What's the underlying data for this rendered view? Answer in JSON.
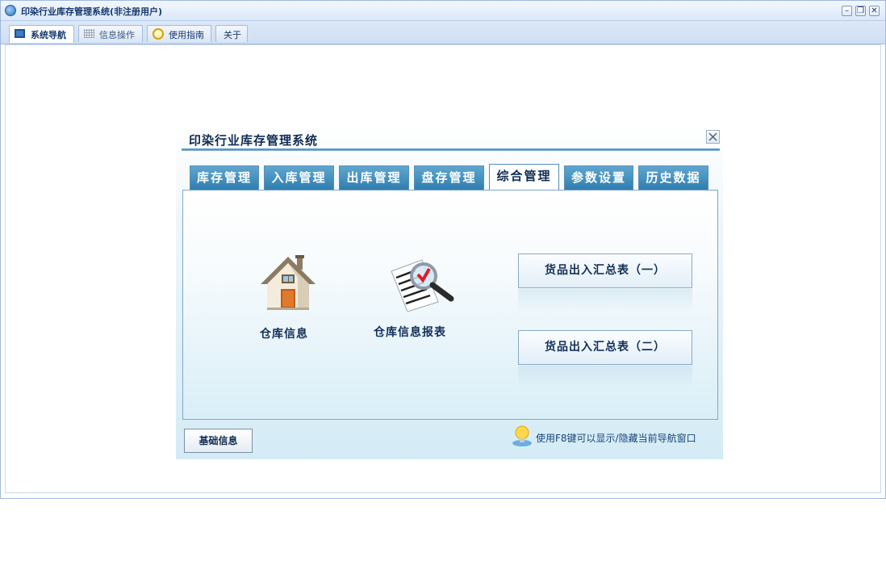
{
  "window": {
    "title": "印染行业库存管理系统(非注册用户)",
    "controls": {
      "minimize": "–",
      "restore": "❐",
      "close": "✕"
    }
  },
  "main_tabs": [
    {
      "label": "系统导航",
      "icon": "monitor-icon",
      "active": true
    },
    {
      "label": "信息操作",
      "icon": "grid-icon",
      "active": false
    },
    {
      "label": "使用指南",
      "icon": "help-icon",
      "active": false
    },
    {
      "label": "关于",
      "icon": "",
      "active": false
    }
  ],
  "dialog": {
    "title": "印染行业库存管理系统",
    "close": "✕",
    "tabs": [
      {
        "label": "库存管理",
        "active": false
      },
      {
        "label": "入库管理",
        "active": false
      },
      {
        "label": "出库管理",
        "active": false
      },
      {
        "label": "盘存管理",
        "active": false
      },
      {
        "label": "综合管理",
        "active": true
      },
      {
        "label": "参数设置",
        "active": false
      },
      {
        "label": "历史数据",
        "active": false
      }
    ],
    "items": [
      {
        "label": "仓库信息",
        "icon": "house-icon"
      },
      {
        "label": "仓库信息报表",
        "icon": "report-magnifier-icon"
      }
    ],
    "report_buttons": [
      {
        "label": "货品出入汇总表（一）"
      },
      {
        "label": "货品出入汇总表（二）"
      }
    ],
    "basic_button": "基础信息",
    "tip": "使用F8键可以显示/隐藏当前导航窗口",
    "colors": {
      "tab_bg": "#2f7eb0",
      "accent": "#3f82b8",
      "text_dark": "#0f2c52"
    }
  }
}
